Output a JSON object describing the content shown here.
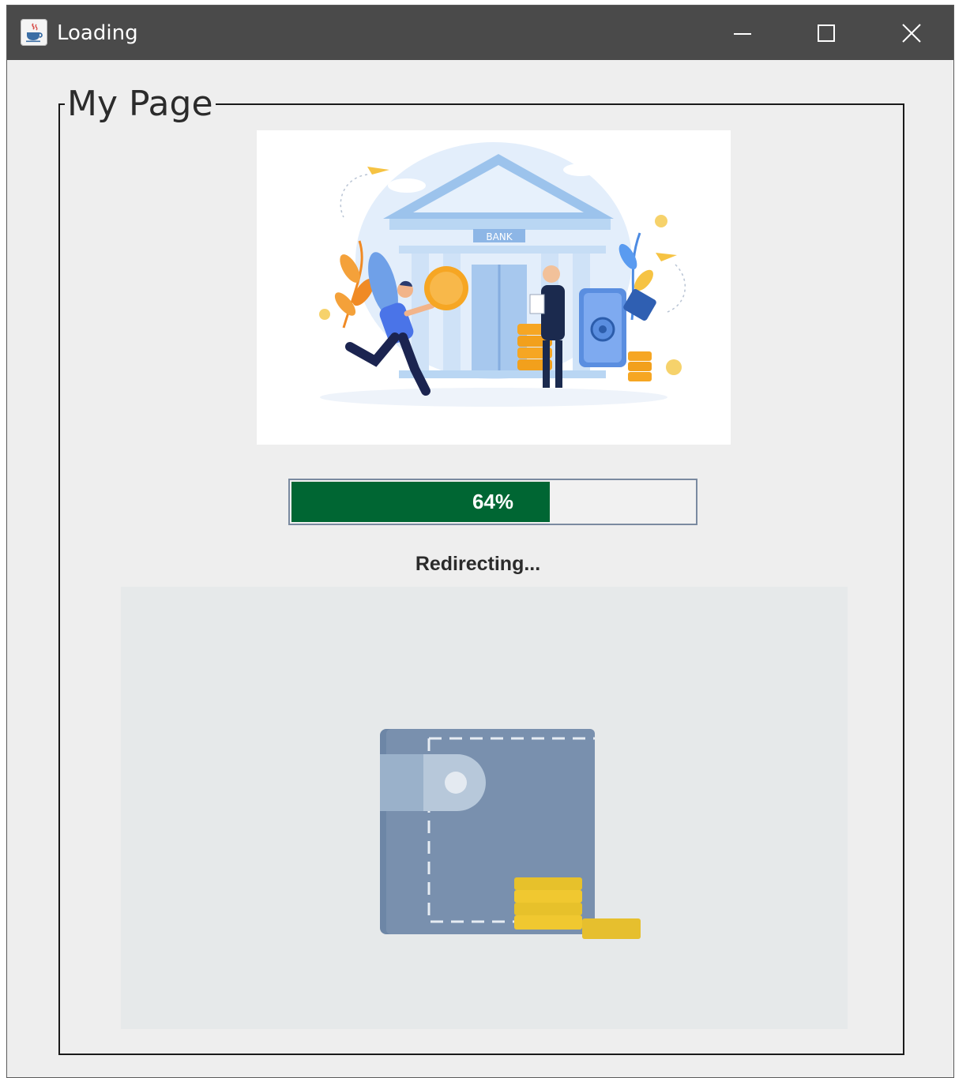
{
  "window": {
    "title": "Loading",
    "app_icon": "java-cup-icon",
    "controls": {
      "minimize": "minimize-icon",
      "maximize": "maximize-icon",
      "close": "close-icon"
    }
  },
  "panel": {
    "title": "My Page"
  },
  "bank_illustration": {
    "sign_text": "BANK"
  },
  "progress": {
    "value": 64,
    "label": "64%",
    "fill_color": "#006633"
  },
  "status": {
    "text": "Redirecting..."
  },
  "colors": {
    "titlebar": "#4a4a4a",
    "background": "#eeeeee"
  }
}
